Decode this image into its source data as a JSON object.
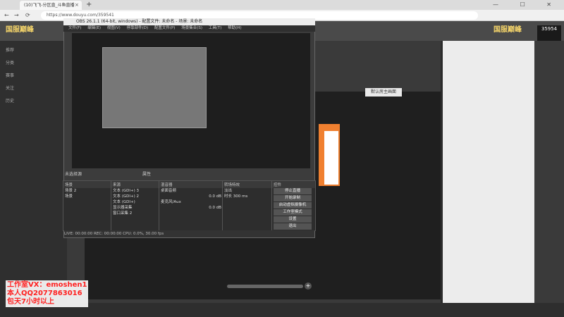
{
  "browser": {
    "tab_title": "(10)飞飞-分区直_斗鱼直播",
    "tab_close": "×",
    "new_tab": "+",
    "url": "https://www.douyu.com/359541",
    "nav": {
      "back": "←",
      "forward": "→",
      "reload": "⟳"
    },
    "window_controls": "— ☐ ✕"
  },
  "douyu": {
    "logo": "国服巅峰",
    "room_number": "35954",
    "join_button": "默认房主画面",
    "sidebar": [
      "推荐",
      "分类",
      "赛事",
      "关注",
      "历史"
    ]
  },
  "obs": {
    "title": "OBS 26.1.1 (64-bit, windows) - 配置文件: 未命名 - 场景: 未命名",
    "menu": [
      "文件(F)",
      "编辑(E)",
      "视图(V)",
      "停靠部件(D)",
      "配置文件(P)",
      "场景集合(S)",
      "工具(T)",
      "帮助(H)"
    ],
    "studio_label": "未选择源",
    "studio_toggle": "属性",
    "docks": {
      "scenes": {
        "header": "场景",
        "items": [
          "场景 2",
          "场景"
        ]
      },
      "sources": {
        "header": "来源",
        "items": [
          "文本 (GDI+) 3",
          "文本 (GDI+) 2",
          "文本 (GDI+)",
          "显示器采集",
          "窗口采集 2"
        ]
      },
      "mixer": {
        "header": "混音器",
        "channels": [
          {
            "name": "桌面音频",
            "level": "0.0 dB"
          },
          {
            "name": "麦克风/Aux",
            "level": "0.0 dB"
          }
        ]
      },
      "transitions": {
        "header": "转场特效",
        "mode": "淡出",
        "duration_label": "时长",
        "duration": "300 ms"
      },
      "controls": {
        "header": "控件",
        "buttons": [
          "停止直播",
          "开始录制",
          "启动虚拟摄像机",
          "工作室模式",
          "设置",
          "退出"
        ]
      }
    },
    "status": "LIVE: 00:00:00   REC: 00:00:00   CPU: 0.0%, 30.00 fps"
  },
  "watermark": {
    "line1": "工作室VX：emoshen1",
    "line2": "本人QQ2077863016",
    "line3": "包天7小时以上"
  },
  "player": {
    "plus": "+"
  }
}
